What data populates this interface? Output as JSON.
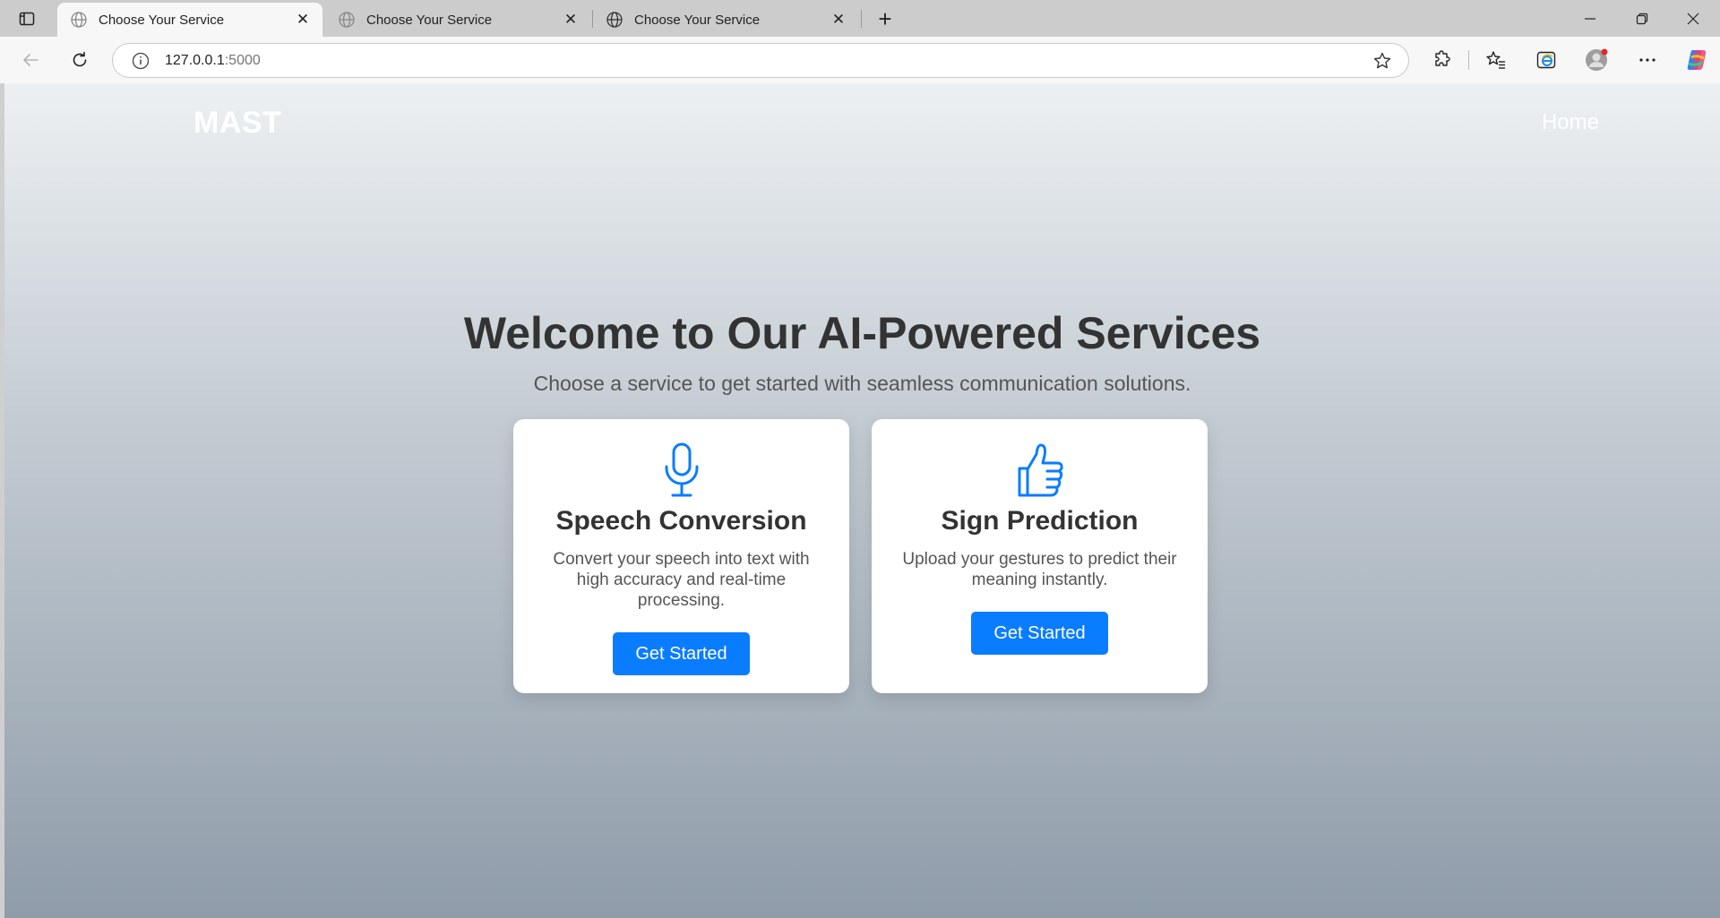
{
  "browser": {
    "tabs": [
      {
        "title": "Choose Your Service",
        "active": true
      },
      {
        "title": "Choose Your Service",
        "active": false
      },
      {
        "title": "Choose Your Service",
        "active": false
      }
    ],
    "url_host": "127.0.0.1",
    "url_port": ":5000"
  },
  "page": {
    "brand": "MAST",
    "nav_home": "Home",
    "hero_title": "Welcome to Our AI-Powered Services",
    "hero_subtitle": "Choose a service to get started with seamless communication solutions.",
    "cards": [
      {
        "icon": "microphone-icon",
        "title": "Speech Conversion",
        "description": "Convert your speech into text with high accuracy and real-time processing.",
        "button": "Get Started"
      },
      {
        "icon": "thumbs-up-icon",
        "title": "Sign Prediction",
        "description": "Upload your gestures to predict their meaning instantly.",
        "button": "Get Started"
      }
    ]
  },
  "colors": {
    "accent": "#0a7cff",
    "heading": "#333333",
    "body_text": "#555555"
  }
}
